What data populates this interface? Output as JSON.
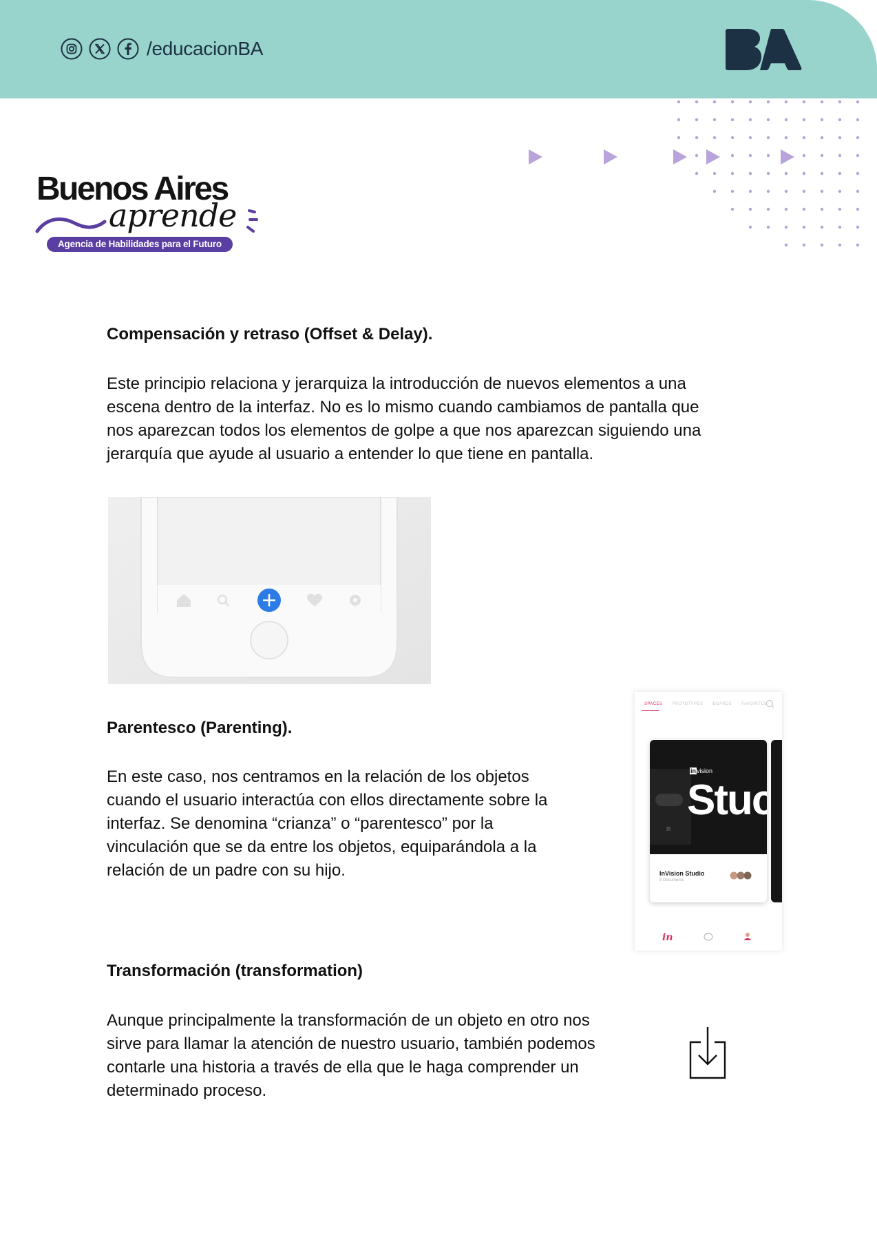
{
  "header": {
    "icons": [
      "instagram-icon",
      "x-icon",
      "facebook-icon"
    ],
    "handle": "/educacionBA",
    "logo_text": "BA",
    "band_color": "#98d3cc",
    "logo_color": "#1c3143"
  },
  "brand": {
    "line1": "Buenos Aires",
    "line2": "aprende",
    "tagline": "Agencia de Habilidades para el Futuro",
    "accent": "#5a3ea1"
  },
  "sections": [
    {
      "heading": "Compensación y retraso (Offset & Delay).",
      "lines": [
        "Este principio relaciona y jerarquiza la introducción de nuevos elementos a una",
        "escena dentro de la interfaz. No es lo mismo cuando cambiamos de pantalla que",
        "nos aparezcan todos los elementos de golpe a que nos aparezcan siguiendo una",
        "jerarquía que ayude al usuario a entender lo que tiene en pantalla."
      ]
    },
    {
      "heading": "Parentesco (Parenting).",
      "lines": [
        "En este caso, nos centramos en la relación de los objetos",
        "cuando el usuario interactúa con ellos directamente sobre la",
        "interfaz. Se denomina “crianza” o “parentesco” por la",
        "vinculación que se da entre los objetos, equiparándola a la",
        "relación de un padre con su hijo."
      ]
    },
    {
      "heading": "Transformación (transformation)",
      "lines": [
        "Aunque principalmente la transformación de un objeto en otro nos",
        "sirve para llamar la atención de nuestro usuario, también podemos",
        "contarle una historia a través de ella que le haga comprender un",
        "determinado proceso."
      ]
    }
  ],
  "phone_mockup": {
    "nav_icons": [
      "home-icon",
      "search-icon",
      "add-icon",
      "heart-icon",
      "gear-icon"
    ],
    "accent": "#2d7be5"
  },
  "invision_mockup": {
    "tabs": [
      "SPACES",
      "PROTOTYPES",
      "BOARDS",
      "FAVORITES"
    ],
    "logo_text": "in",
    "logo_suffix": "vision",
    "hero_text": "Stuc",
    "card_title": "InVision Studio",
    "card_subtitle": "8 Documents",
    "footer_icons": [
      "invision-icon",
      "chat-icon",
      "user-icon"
    ],
    "accent": "#d4335f"
  },
  "download_icon": "download-icon"
}
